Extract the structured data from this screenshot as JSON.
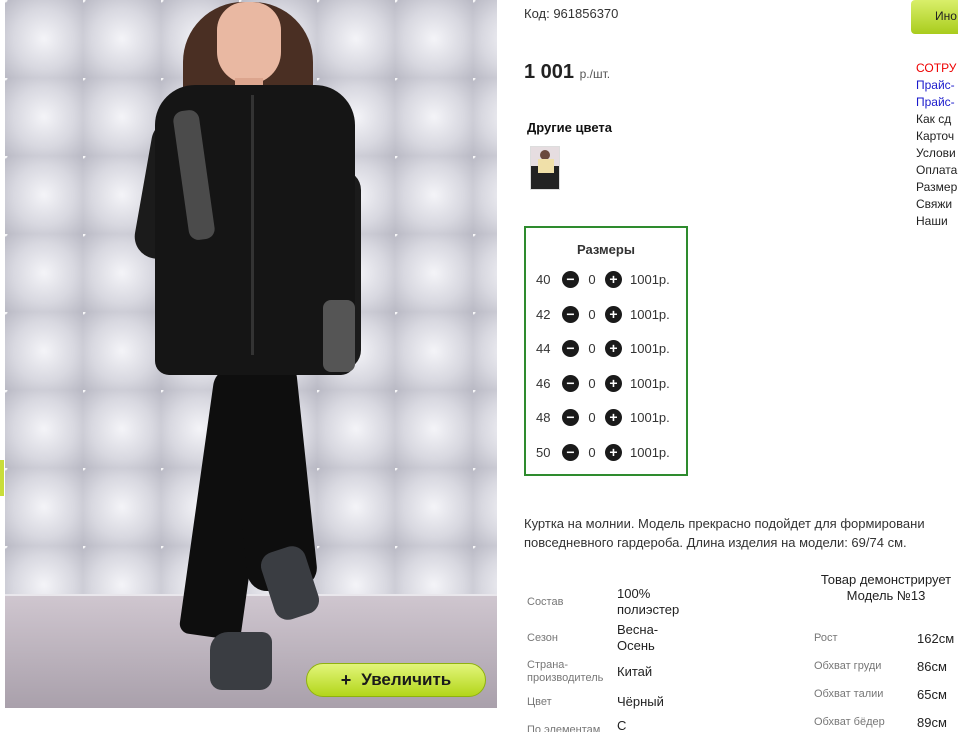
{
  "product": {
    "code_label": "Код: 961856370",
    "price": "1 001",
    "price_unit": "р./шт.",
    "zoom_plus": "+",
    "zoom_label": "Увеличить",
    "top_button_label": "Ино"
  },
  "other_colors": {
    "title": "Другие цвета"
  },
  "sizes": {
    "title": "Размеры",
    "minus_glyph": "−",
    "plus_glyph": "+",
    "rows": [
      {
        "size": "40",
        "qty": "0",
        "price": "1001р."
      },
      {
        "size": "42",
        "qty": "0",
        "price": "1001р."
      },
      {
        "size": "44",
        "qty": "0",
        "price": "1001р."
      },
      {
        "size": "46",
        "qty": "0",
        "price": "1001р."
      },
      {
        "size": "48",
        "qty": "0",
        "price": "1001р."
      },
      {
        "size": "50",
        "qty": "0",
        "price": "1001р."
      }
    ]
  },
  "description": {
    "line1": "Куртка на молнии. Модель прекрасно подойдет для формировани",
    "line2": "повседневного гардероба. Длина изделия на модели: 69/74 см."
  },
  "specs": [
    {
      "label": "Состав",
      "value": "100% полиэстер"
    },
    {
      "label": "Сезон",
      "value": "Весна-Осень"
    },
    {
      "label": "Страна-производитель",
      "value": "Китай"
    },
    {
      "label": "Цвет",
      "value": "Чёрный"
    },
    {
      "label": "По элементам",
      "value": "С"
    }
  ],
  "model": {
    "title": "Товар демонстрирует Модель №13",
    "measurements": [
      {
        "label": "Рост",
        "value": "162см"
      },
      {
        "label": "Обхват груди",
        "value": "86см"
      },
      {
        "label": "Обхват талии",
        "value": "65см"
      },
      {
        "label": "Обхват бёдер",
        "value": "89см"
      }
    ]
  },
  "side_menu": [
    {
      "label": "СОТРУ",
      "color": "red"
    },
    {
      "label": "Прайс-",
      "color": "blue"
    },
    {
      "label": "Прайс-",
      "color": "blue"
    },
    {
      "label": "Как сд",
      "color": "dark"
    },
    {
      "label": "Карточ",
      "color": "dark"
    },
    {
      "label": "Услови",
      "color": "dark"
    },
    {
      "label": "Оплата",
      "color": "dark"
    },
    {
      "label": "Размер",
      "color": "dark"
    },
    {
      "label": "Свяжи",
      "color": "dark"
    },
    {
      "label": "Наши",
      "color": "dark"
    }
  ],
  "colors": {
    "accent_green": "#2e8b2e",
    "button_lime": "#b3d61a",
    "menu_red": "#e00000",
    "menu_blue": "#1a1acc"
  }
}
